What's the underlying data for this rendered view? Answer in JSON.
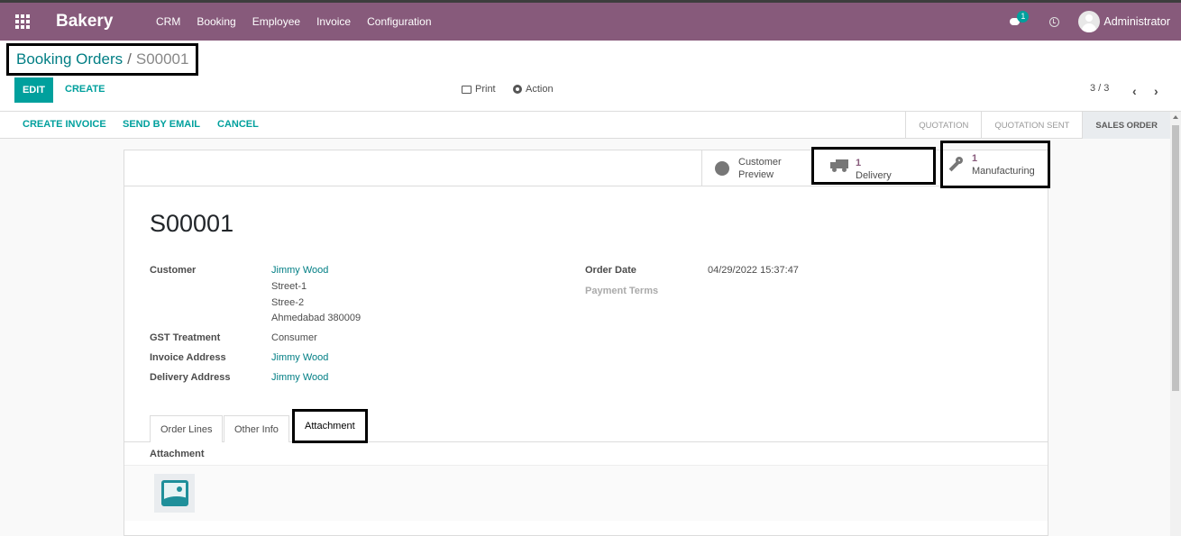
{
  "navbar": {
    "app_name": "Bakery",
    "menu": [
      "CRM",
      "Booking",
      "Employee",
      "Invoice",
      "Configuration"
    ],
    "chat_badge": "1",
    "user": "Administrator",
    "bg_color": "#875a7b"
  },
  "breadcrumb": {
    "parent": "Booking Orders",
    "separator": "/",
    "current": "S00001"
  },
  "toolbar": {
    "edit_label": "EDIT",
    "create_label": "CREATE",
    "print_label": "Print",
    "action_label": "Action",
    "pager": "3 / 3"
  },
  "statusbar": {
    "buttons": [
      "CREATE INVOICE",
      "SEND BY EMAIL",
      "CANCEL"
    ],
    "stages": [
      "QUOTATION",
      "QUOTATION SENT",
      "SALES ORDER"
    ],
    "active_stage": "SALES ORDER"
  },
  "smart_buttons": {
    "preview": {
      "line1": "Customer",
      "line2": "Preview"
    },
    "delivery": {
      "count": "1",
      "label": "Delivery"
    },
    "manufacturing": {
      "count": "1",
      "label": "Manufacturing"
    }
  },
  "record": {
    "title": "S00001",
    "customer_label": "Customer",
    "customer_name": "Jimmy Wood",
    "address": [
      "Street-1",
      "Stree-2",
      "Ahmedabad 380009"
    ],
    "gst_label": "GST Treatment",
    "gst_value": "Consumer",
    "invoice_address_label": "Invoice Address",
    "invoice_address": "Jimmy Wood",
    "delivery_address_label": "Delivery Address",
    "delivery_address": "Jimmy Wood",
    "order_date_label": "Order Date",
    "order_date": "04/29/2022 15:37:47",
    "payment_terms_label": "Payment Terms"
  },
  "notebook": {
    "tabs": [
      "Order Lines",
      "Other Info",
      "Attachment"
    ],
    "active_tab": "Attachment",
    "attachment_label": "Attachment"
  },
  "colors": {
    "accent": "#00a09d",
    "link": "#017e84",
    "brand": "#875a7b"
  }
}
